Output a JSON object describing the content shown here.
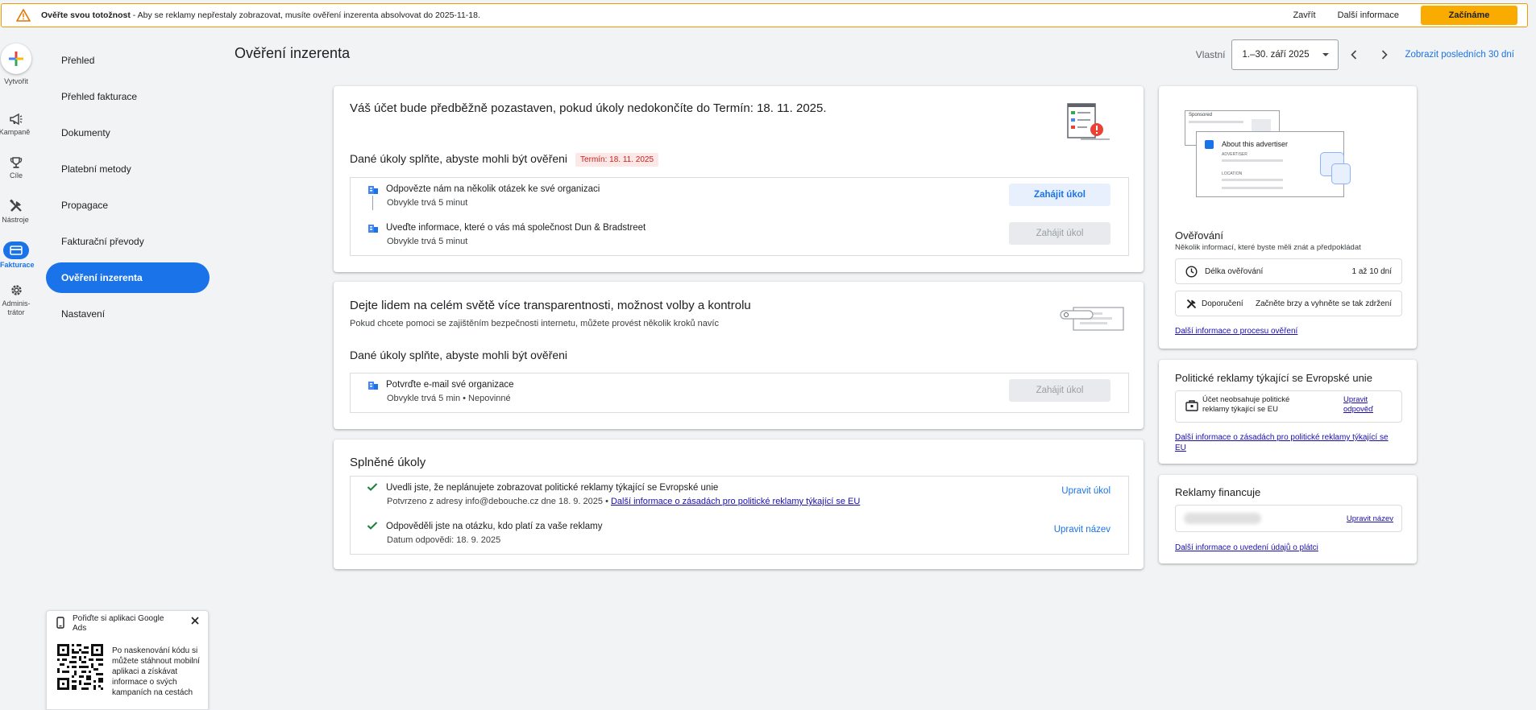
{
  "banner": {
    "title": "Ověřte svou totožnost",
    "message": " - Aby se reklamy nepřestaly zobrazovat, musíte ověření inzerenta absolvovat do 2025-11-18.",
    "close_label": "Zavřít",
    "more_label": "Další informace",
    "start_label": "Začínáme"
  },
  "rail": {
    "create": "Vytvořit",
    "campaigns": "Kampaně",
    "goals": "Cíle",
    "tools": "Nástroje",
    "billing": "Fakturace",
    "admin": "Adminis-trátor"
  },
  "sidenav": [
    "Přehled",
    "Přehled fakturace",
    "Dokumenty",
    "Platební metody",
    "Propagace",
    "Fakturační převody",
    "Ověření inzerenta",
    "Nastavení"
  ],
  "header": {
    "title": "Ověření inzerenta",
    "range_label": "Vlastní",
    "date_range": "1.–30. září 2025",
    "last30": "Zobrazit posledních 30 dní"
  },
  "card1": {
    "title": "Váš účet bude předběžně pozastaven, pokud úkoly nedokončíte do Termín: 18. 11. 2025.",
    "section": "Dané úkoly splňte, abyste mohli být ověřeni",
    "deadline": "Termín: 18. 11. 2025",
    "tasks": [
      {
        "title": "Odpovězte nám na několik otázek ke své organizaci",
        "sub": "Obvykle trvá 5 minut",
        "button": "Zahájit úkol"
      },
      {
        "title": "Uveďte informace, které o vás má společnost Dun & Bradstreet",
        "sub": "Obvykle trvá 5 minut",
        "button": "Zahájit úkol"
      }
    ]
  },
  "card2": {
    "title": "Dejte lidem na celém světě více transparentnosti, možnost volby a kontrolu",
    "subtitle": "Pokud chcete pomoci se zajištěním bezpečnosti internetu, můžete provést několik kroků navíc",
    "section": "Dané úkoly splňte, abyste mohli být ověřeni",
    "tasks": [
      {
        "title": "Potvrďte e-mail své organizace",
        "sub": "Obvykle trvá 5 min • Nepovinné",
        "button": "Zahájit úkol"
      }
    ]
  },
  "card3": {
    "title": "Splněné úkoly",
    "tasks": [
      {
        "title": "Uvedli jste, že neplánujete zobrazovat politické reklamy týkající se Evropské unie",
        "sub": "Potvrzeno z adresy info@debouche.cz dne 18. 9. 2025 • ",
        "sub_link": "Další informace o zásadách pro politické reklamy týkající se EU",
        "action": "Upravit úkol"
      },
      {
        "title": "Odpověděli jste na otázku, kdo platí za vaše reklamy",
        "sub": "Datum odpovědi: 18. 9. 2025",
        "action": "Upravit název"
      }
    ]
  },
  "side1": {
    "illus_sponsored": "Sponsored",
    "illus_about": "About this advertiser",
    "illus_advertiser": "ADVERTISER",
    "illus_location": "LOCATION",
    "title": "Ověřování",
    "subtitle": "Několik informací, které byste měli znát a předpokládat",
    "rows": [
      {
        "label": "Délka ověřování",
        "value": "1 až 10 dní"
      },
      {
        "label": "Doporučení",
        "value": "Začněte brzy a vyhněte se tak zdržení"
      }
    ],
    "link": "Další informace o procesu ověření"
  },
  "side2": {
    "title": "Politické reklamy týkající se Evropské unie",
    "row_text": "Účet neobsahuje politické reklamy týkající se EU",
    "row_action": "Upravit odpověď",
    "link": "Další informace o zásadách pro politické reklamy týkající se EU"
  },
  "side3": {
    "title": "Reklamy financuje",
    "row_action": "Upravit název",
    "link": "Další informace o uvedení údajů o plátci"
  },
  "promo": {
    "title": "Pořiďte si aplikaci Google Ads",
    "text": "Po naskenování kódu si můžete stáhnout mobilní aplikaci a získávat informace o svých kampaních na cestách"
  },
  "colors": {
    "primary": "#1a73e8",
    "warning": "#f9ab00",
    "error": "#d93025"
  }
}
